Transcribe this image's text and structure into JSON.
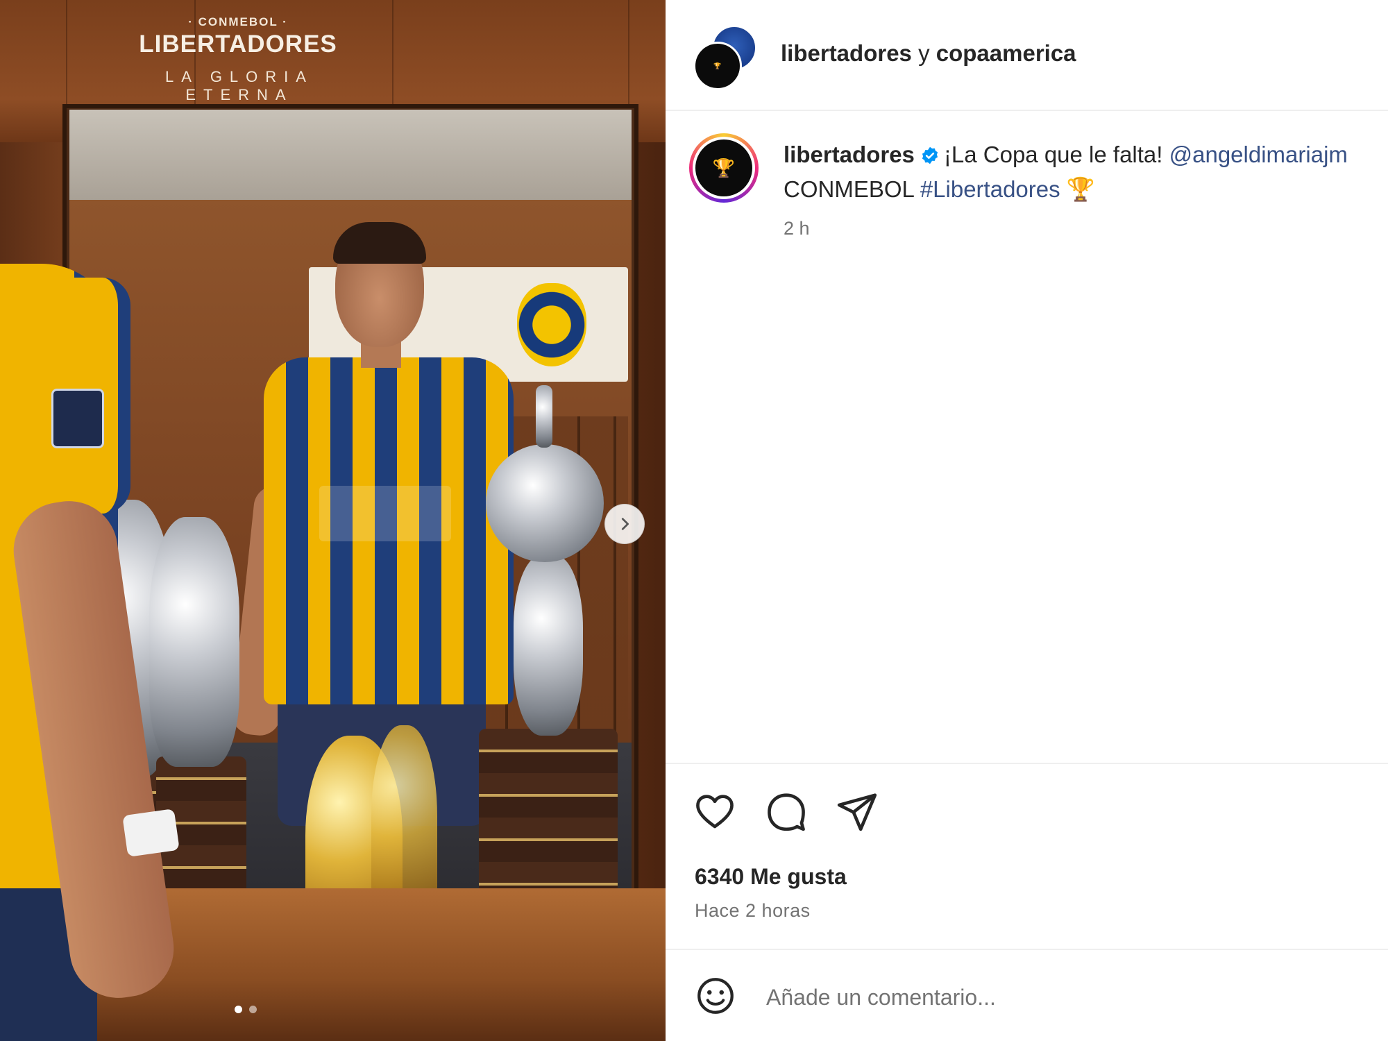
{
  "media": {
    "logo_top": "· CONMEBOL ·",
    "logo_main": "LIBERTADORES",
    "logo_sub": "LA GLORIA ETERNA",
    "carousel_total": 2,
    "carousel_active": 1,
    "next_icon": "chevron-right-icon"
  },
  "header": {
    "account_1": "libertadores",
    "joiner": " y ",
    "account_2": "copaamerica"
  },
  "caption": {
    "username": "libertadores",
    "verified_icon": "verified-badge-icon",
    "text_1": "¡La Copa que le falta! ",
    "mention": "@angeldimariajm",
    "text_2": "CONMEBOL ",
    "hashtag": "#Libertadores",
    "emoji": "🏆",
    "time": "2 h"
  },
  "actions": {
    "like_icon": "heart-icon",
    "comment_icon": "comment-icon",
    "share_icon": "send-icon",
    "likes": "6340 Me gusta",
    "posted_ago": "Hace 2 horas"
  },
  "comment": {
    "emoji_icon": "smiley-icon",
    "placeholder": "Añade un comentario..."
  },
  "colors": {
    "link": "#385185",
    "verified": "#0095f6",
    "muted": "#737373",
    "text": "#262626"
  }
}
